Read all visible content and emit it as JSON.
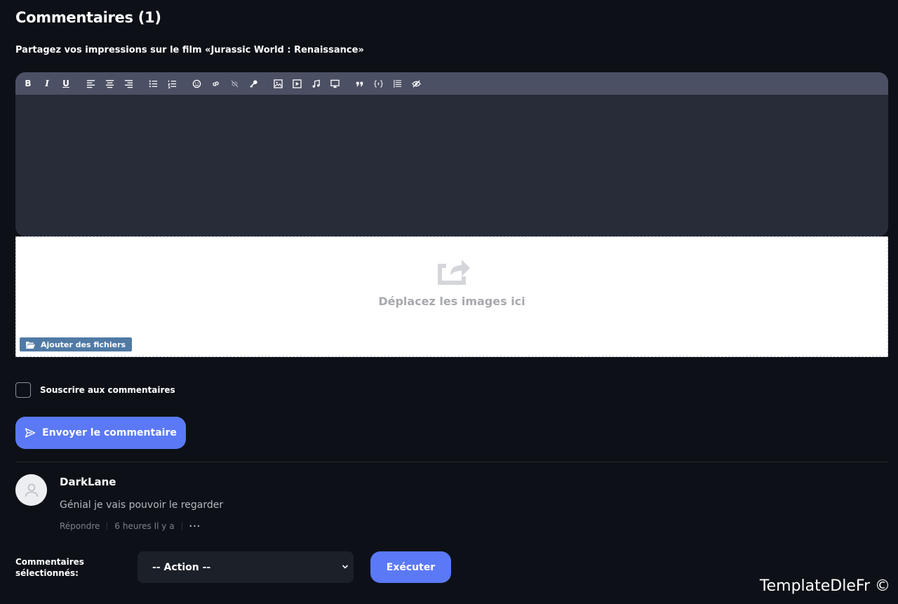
{
  "header": {
    "title": "Commentaires (1)",
    "subtitle": "Partagez vos impressions sur le film «Jurassic World : Renaissance»"
  },
  "toolbar": {
    "buttons": [
      {
        "name": "bold-icon",
        "glyph": "B"
      },
      {
        "name": "italic-icon",
        "glyph": "I"
      },
      {
        "name": "underline-icon",
        "glyph": "U"
      },
      {
        "name": "align-left-icon"
      },
      {
        "name": "align-center-icon"
      },
      {
        "name": "align-right-icon"
      },
      {
        "name": "bullet-list-icon"
      },
      {
        "name": "numbered-list-icon"
      },
      {
        "name": "emoji-icon"
      },
      {
        "name": "link-icon"
      },
      {
        "name": "unlink-icon"
      },
      {
        "name": "key-icon"
      },
      {
        "name": "image-icon"
      },
      {
        "name": "video-icon"
      },
      {
        "name": "audio-icon"
      },
      {
        "name": "media-embed-icon"
      },
      {
        "name": "quote-icon"
      },
      {
        "name": "code-icon"
      },
      {
        "name": "spoiler-icon"
      },
      {
        "name": "hide-icon"
      }
    ]
  },
  "dropzone": {
    "text": "Déplacez les images ici",
    "add_files_label": "Ajouter des fichiers",
    "icon": "share-upload-icon"
  },
  "subscribe": {
    "label": "Souscrire aux commentaires",
    "checked": false
  },
  "send_button": {
    "label": "Envoyer le commentaire",
    "icon": "send-icon"
  },
  "comments": [
    {
      "author": "DarkLane",
      "text": "Génial je vais pouvoir le regarder",
      "reply_label": "Répondre",
      "time": "6 heures Il y a",
      "more": "···"
    }
  ],
  "mass_action": {
    "label": "Commentaires sélectionnés:",
    "select_value": "-- Action --",
    "execute_label": "Exécuter"
  },
  "watermark": "TemplateDleFr ©",
  "colors": {
    "background": "#0d1117",
    "accent": "#5b79f6",
    "editor_bg": "#282c39",
    "toolbar_bg": "#4b5064",
    "add_files_bg": "#507aa5"
  }
}
